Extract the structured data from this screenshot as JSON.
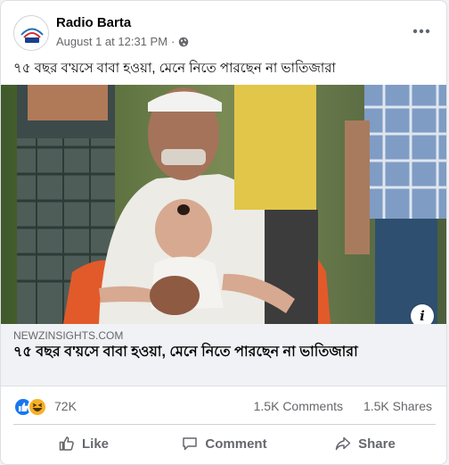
{
  "post": {
    "page_name": "Radio Barta",
    "timestamp": "August 1 at 12:31 PM",
    "separator": "·",
    "privacy_icon": "globe-icon",
    "text": "৭৫ বছর ব'য়সে বাবা হওয়া, মেনে নিতে পারছেন না ভাতিজারা",
    "avatar_logo_text": "বাতা"
  },
  "link_preview": {
    "domain": "NEWZINSIGHTS.COM",
    "title": "৭৫ বছর ব'য়সে বাবা হওয়া, মেনে নিতে পারছেন না ভাতিজারা",
    "info_icon": "i"
  },
  "stats": {
    "reactions": [
      "like-icon",
      "haha-icon"
    ],
    "reaction_count": "72K",
    "comments": "1.5K Comments",
    "shares": "1.5K Shares"
  },
  "actions": {
    "like": "Like",
    "comment": "Comment",
    "share": "Share"
  },
  "colors": {
    "like_blue": "#1877f2",
    "haha_yellow": "#f7b125",
    "secondary_text": "#65676b",
    "card_bg": "#ffffff",
    "preview_bg": "#f0f2f5"
  }
}
